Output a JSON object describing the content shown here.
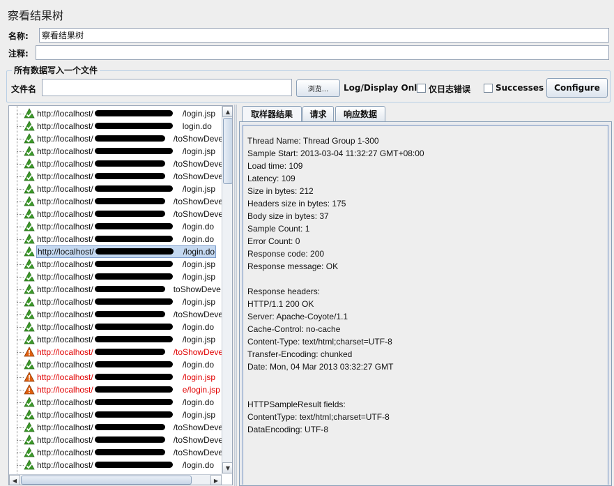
{
  "title": "察看结果树",
  "name_label": "名称:",
  "name_value": "察看结果树",
  "comment_label": "注释:",
  "comment_value": "",
  "file_group_title": "所有数据写入一个文件",
  "filename_label": "文件名",
  "filename_value": "",
  "browse_label": "浏览...",
  "log_display_label": "Log/Display Only:",
  "errors_only_label": "仅日志错误",
  "successes_label": "Successes",
  "configure_label": "Configure",
  "tabs": [
    "取样器结果",
    "请求",
    "响应数据"
  ],
  "tree_items": [
    {
      "text": "http://localhost/",
      "suffix": "/login.jsp",
      "status": "ok"
    },
    {
      "text": "http://localhost/",
      "suffix": "login.do",
      "status": "ok"
    },
    {
      "text": "http://localhost/",
      "suffix": "/toShowDeve",
      "status": "ok"
    },
    {
      "text": "http://localhost/",
      "suffix": "/login.jsp",
      "status": "ok"
    },
    {
      "text": "http://localhost/",
      "suffix": "/toShowDeve",
      "status": "ok"
    },
    {
      "text": "http://localhost/",
      "suffix": "/toShowDeve",
      "status": "ok"
    },
    {
      "text": "http://localhost/",
      "suffix": "/login.jsp",
      "status": "ok"
    },
    {
      "text": "http://localhost/",
      "suffix": "/toShowDeve",
      "status": "ok"
    },
    {
      "text": "http://localhost/",
      "suffix": "/toShowDeve",
      "status": "ok"
    },
    {
      "text": "http://localhost/",
      "suffix": "/login.do",
      "status": "ok"
    },
    {
      "text": "http://localhost/",
      "suffix": "/login.do",
      "status": "ok"
    },
    {
      "text": "http://localhost/",
      "suffix": "/login.do",
      "status": "selected"
    },
    {
      "text": "http://localhost/",
      "suffix": "/login.jsp",
      "status": "ok"
    },
    {
      "text": "http://localhost/",
      "suffix": "/login.jsp",
      "status": "ok"
    },
    {
      "text": "http://localhost/",
      "suffix": "toShowDeve",
      "status": "ok"
    },
    {
      "text": "http://localhost/",
      "suffix": "/login.jsp",
      "status": "ok"
    },
    {
      "text": "http://localhost/",
      "suffix": "/toShowDeve",
      "status": "ok"
    },
    {
      "text": "http://localhost/",
      "suffix": "/login.do",
      "status": "ok"
    },
    {
      "text": "http://localhost/",
      "suffix": "/login.jsp",
      "status": "ok"
    },
    {
      "text": "http://localhost/",
      "suffix": "/toShowDeve",
      "status": "error"
    },
    {
      "text": "http://localhost/",
      "suffix": "/login.do",
      "status": "ok"
    },
    {
      "text": "http://localhost/",
      "suffix": "/login.jsp",
      "status": "error"
    },
    {
      "text": "http://localhost/",
      "suffix": "e/login.jsp",
      "status": "error"
    },
    {
      "text": "http://localhost/",
      "suffix": "/login.do",
      "status": "ok"
    },
    {
      "text": "http://localhost/",
      "suffix": "/login.jsp",
      "status": "ok"
    },
    {
      "text": "http://localhost/",
      "suffix": "/toShowDeve",
      "status": "ok"
    },
    {
      "text": "http://localhost/",
      "suffix": "/toShowDeve",
      "status": "ok"
    },
    {
      "text": "http://localhost/",
      "suffix": "/toShowDeve",
      "status": "ok"
    },
    {
      "text": "http://localhost/",
      "suffix": "/login.do",
      "status": "ok"
    }
  ],
  "result_lines": [
    "Thread Name: Thread Group 1-300",
    "Sample Start: 2013-03-04 11:32:27 GMT+08:00",
    "Load time: 109",
    "Latency: 109",
    "Size in bytes: 212",
    "Headers size in bytes: 175",
    "Body size in bytes: 37",
    "Sample Count: 1",
    "Error Count: 0",
    "Response code: 200",
    "Response message: OK",
    "",
    "Response headers:",
    "HTTP/1.1 200 OK",
    "Server: Apache-Coyote/1.1",
    "Cache-Control: no-cache",
    "Content-Type: text/html;charset=UTF-8",
    "Transfer-Encoding: chunked",
    "Date: Mon, 04 Mar 2013 03:32:27 GMT",
    "",
    "",
    "HTTPSampleResult fields:",
    "ContentType: text/html;charset=UTF-8",
    "DataEncoding: UTF-8"
  ],
  "colors": {
    "ok_icon": "#3c9a2a",
    "error_icon": "#e06010",
    "error_text": "#e00000",
    "selection": "#c4d8f0"
  }
}
